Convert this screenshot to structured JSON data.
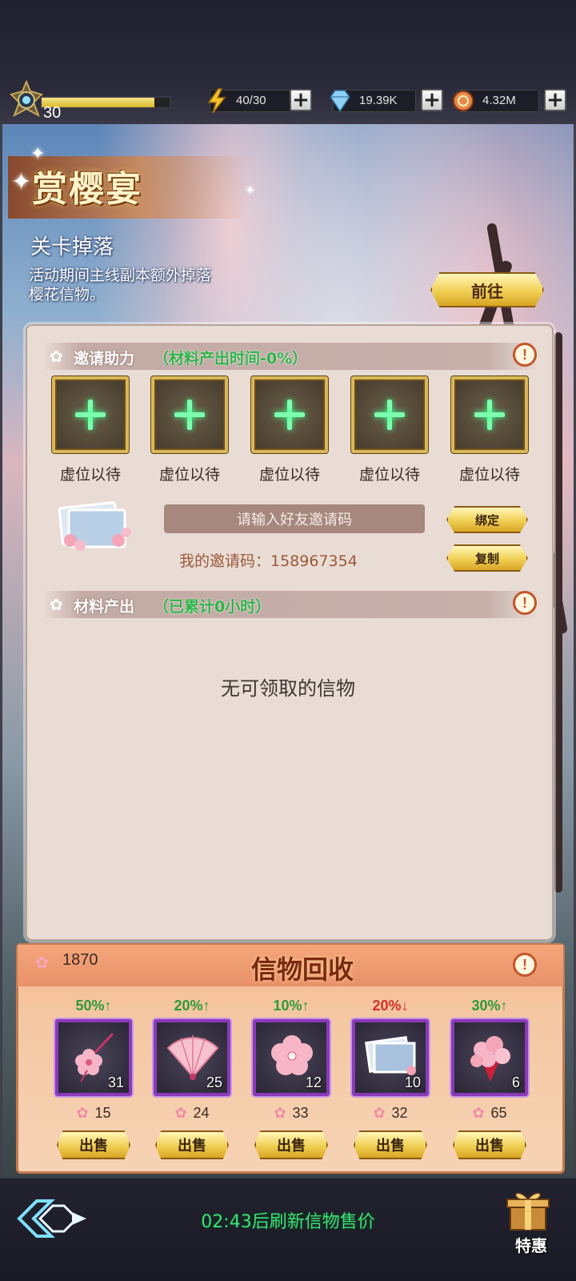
{
  "player": {
    "level": "30",
    "exp_fraction": 0.88
  },
  "resources": {
    "stamina": {
      "icon": "lightning-icon",
      "value": "40/30"
    },
    "gems": {
      "icon": "diamond-icon",
      "value": "19.39K"
    },
    "coins": {
      "icon": "coin-icon",
      "value": "4.32M"
    }
  },
  "banner": {
    "title": "赏樱宴",
    "subtitle": "关卡掉落",
    "description": "活动期间主线副本额外掉落樱花信物。",
    "go_button": "前往"
  },
  "invite": {
    "header": "邀请助力",
    "note": "（材料产出时间-0%）",
    "slots": [
      "虚位以待",
      "虚位以待",
      "虚位以待",
      "虚位以待",
      "虚位以待"
    ],
    "input_placeholder": "请输入好友邀请码",
    "bind_button": "绑定",
    "copy_button": "复制",
    "my_code_label": "我的邀请码：158967354"
  },
  "output": {
    "header": "材料产出",
    "note": "（已累计0小时）",
    "empty_text": "无可领取的信物"
  },
  "recycle": {
    "currency": "1870",
    "title": "信物回收",
    "items": [
      {
        "icon": "sakura-hairpin-icon",
        "pct": "50%↑",
        "trend": "up",
        "count": "31",
        "price": "15",
        "sell": "出售"
      },
      {
        "icon": "sakura-fan-icon",
        "pct": "20%↑",
        "trend": "up",
        "count": "25",
        "price": "24",
        "sell": "出售"
      },
      {
        "icon": "sakura-brooch-icon",
        "pct": "10%↑",
        "trend": "up",
        "count": "12",
        "price": "33",
        "sell": "出售"
      },
      {
        "icon": "sakura-photo-icon",
        "pct": "20%↓",
        "trend": "down",
        "count": "10",
        "price": "32",
        "sell": "出售"
      },
      {
        "icon": "sakura-bouquet-icon",
        "pct": "30%↑",
        "trend": "up",
        "count": "6",
        "price": "65",
        "sell": "出售"
      }
    ]
  },
  "footer": {
    "refresh_text": "02:43后刷新信物售价",
    "gift_label": "特惠"
  },
  "colors": {
    "accent_gold": "#f0cf54",
    "green_text": "#3fe07a",
    "up": "#2e9a3c",
    "down": "#d2302a"
  }
}
